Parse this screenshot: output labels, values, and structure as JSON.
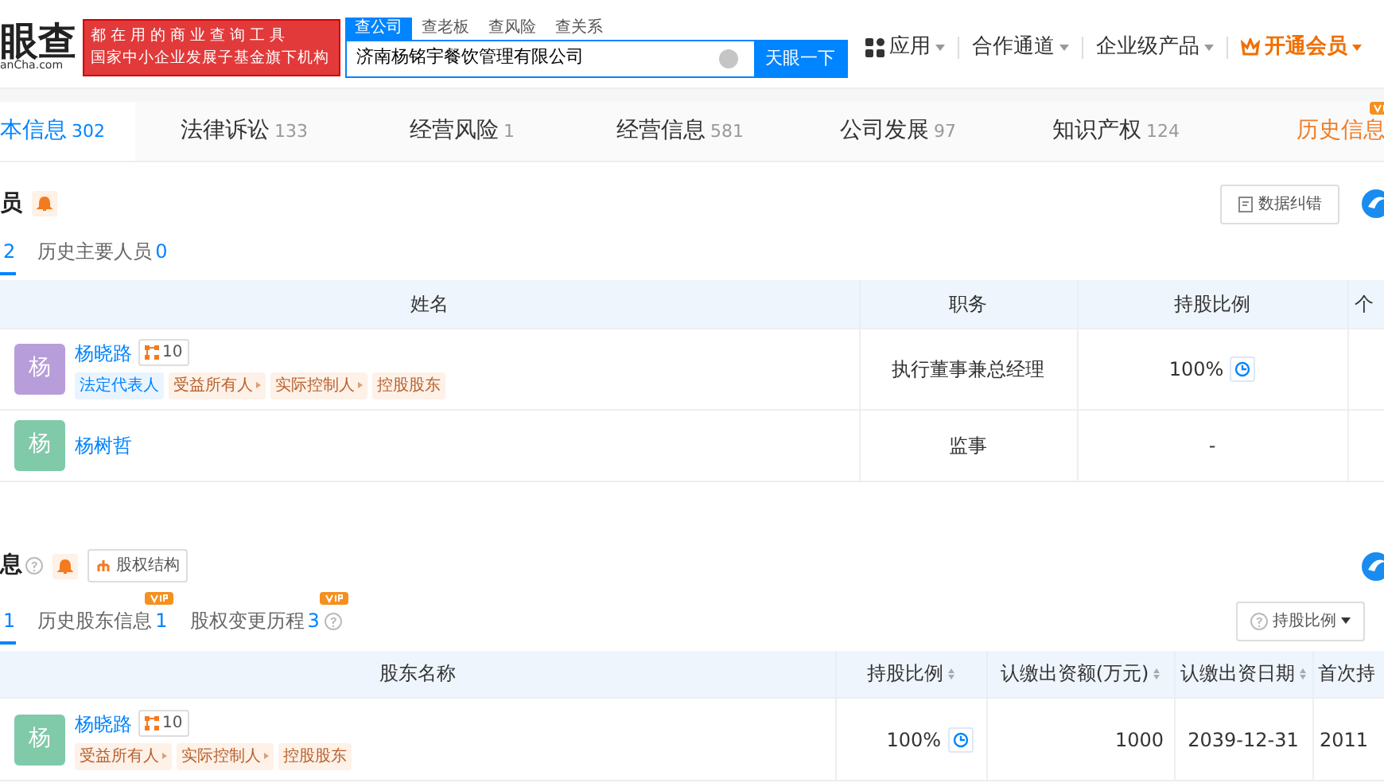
{
  "header": {
    "logo": "眼查",
    "logo_domain": "anCha.com",
    "slogan": [
      "都在用的商业查询工具",
      "国家中小企业发展子基金旗下机构"
    ],
    "search_tabs": [
      {
        "label": "查公司",
        "selected": true
      },
      {
        "label": "查老板",
        "selected": false
      },
      {
        "label": "查风险",
        "selected": false
      },
      {
        "label": "查关系",
        "selected": false
      }
    ],
    "search": {
      "value": "济南杨铭宇餐饮管理有限公司"
    },
    "search_button": "天眼一下",
    "nav": [
      {
        "label": "应用",
        "kind": "apps"
      },
      {
        "label": "合作通道",
        "kind": "plain"
      },
      {
        "label": "企业级产品",
        "kind": "plain"
      },
      {
        "label": "开通会员",
        "kind": "vip"
      }
    ]
  },
  "main_tabs": [
    {
      "label": "本信息",
      "count": "302",
      "selected": true,
      "kind": "plain"
    },
    {
      "label": "法律诉讼",
      "count": "133",
      "selected": false,
      "kind": "plain"
    },
    {
      "label": "经营风险",
      "count": "1",
      "selected": false,
      "kind": "plain"
    },
    {
      "label": "经营信息",
      "count": "581",
      "selected": false,
      "kind": "plain"
    },
    {
      "label": "公司发展",
      "count": "97",
      "selected": false,
      "kind": "plain"
    },
    {
      "label": "知识产权",
      "count": "124",
      "selected": false,
      "kind": "plain"
    },
    {
      "label": "历史信息",
      "selected": false,
      "kind": "vip"
    }
  ],
  "members": {
    "title": "员",
    "correction_button": "数据纠错",
    "subtabs": [
      {
        "count": "2",
        "selected": true
      },
      {
        "label": "历史主要人员",
        "count": "0",
        "selected": false
      }
    ],
    "columns": [
      "姓名",
      "职务",
      "持股比例",
      "个"
    ],
    "rows": [
      {
        "avatar": "杨",
        "color": "#b89ddb",
        "name": "杨晓路",
        "badge": "10",
        "tags": [
          {
            "label": "法定代表人",
            "kind": "legal"
          },
          {
            "label": "受益所有人",
            "kind": "role"
          },
          {
            "label": "实际控制人",
            "kind": "role"
          },
          {
            "label": "控股股东",
            "kind": "plain"
          }
        ],
        "position": "执行董事兼总经理",
        "share": "100%",
        "share_chart": true
      },
      {
        "avatar": "杨",
        "color": "#80c9a9",
        "name": "杨树哲",
        "position": "监事",
        "share": "-",
        "share_chart": false
      }
    ]
  },
  "shareholders": {
    "title": "息",
    "structure_button": "股权结构",
    "subtabs": [
      {
        "count": "1",
        "selected": true,
        "vip": false,
        "help": false
      },
      {
        "label": "历史股东信息",
        "count": "1",
        "selected": false,
        "vip": true,
        "help": false
      },
      {
        "label": "股权变更历程",
        "count": "3",
        "selected": false,
        "vip": true,
        "help": true
      }
    ],
    "sort_button": "持股比例",
    "columns": [
      {
        "label": "股东名称",
        "sortable": false
      },
      {
        "label": "持股比例",
        "sortable": true
      },
      {
        "label": "认缴出资额(万元)",
        "sortable": true
      },
      {
        "label": "认缴出资日期",
        "sortable": true
      },
      {
        "label": "首次持",
        "sortable": false
      }
    ],
    "rows": [
      {
        "avatar": "杨",
        "color": "#80c9a9",
        "name": "杨晓路",
        "badge": "10",
        "tags": [
          {
            "label": "受益所有人",
            "kind": "role"
          },
          {
            "label": "实际控制人",
            "kind": "role"
          },
          {
            "label": "控股股东",
            "kind": "plain"
          }
        ],
        "share": "100%",
        "share_chart": true,
        "amount": "1000",
        "date": "2039-12-31",
        "first": "2011"
      }
    ]
  }
}
